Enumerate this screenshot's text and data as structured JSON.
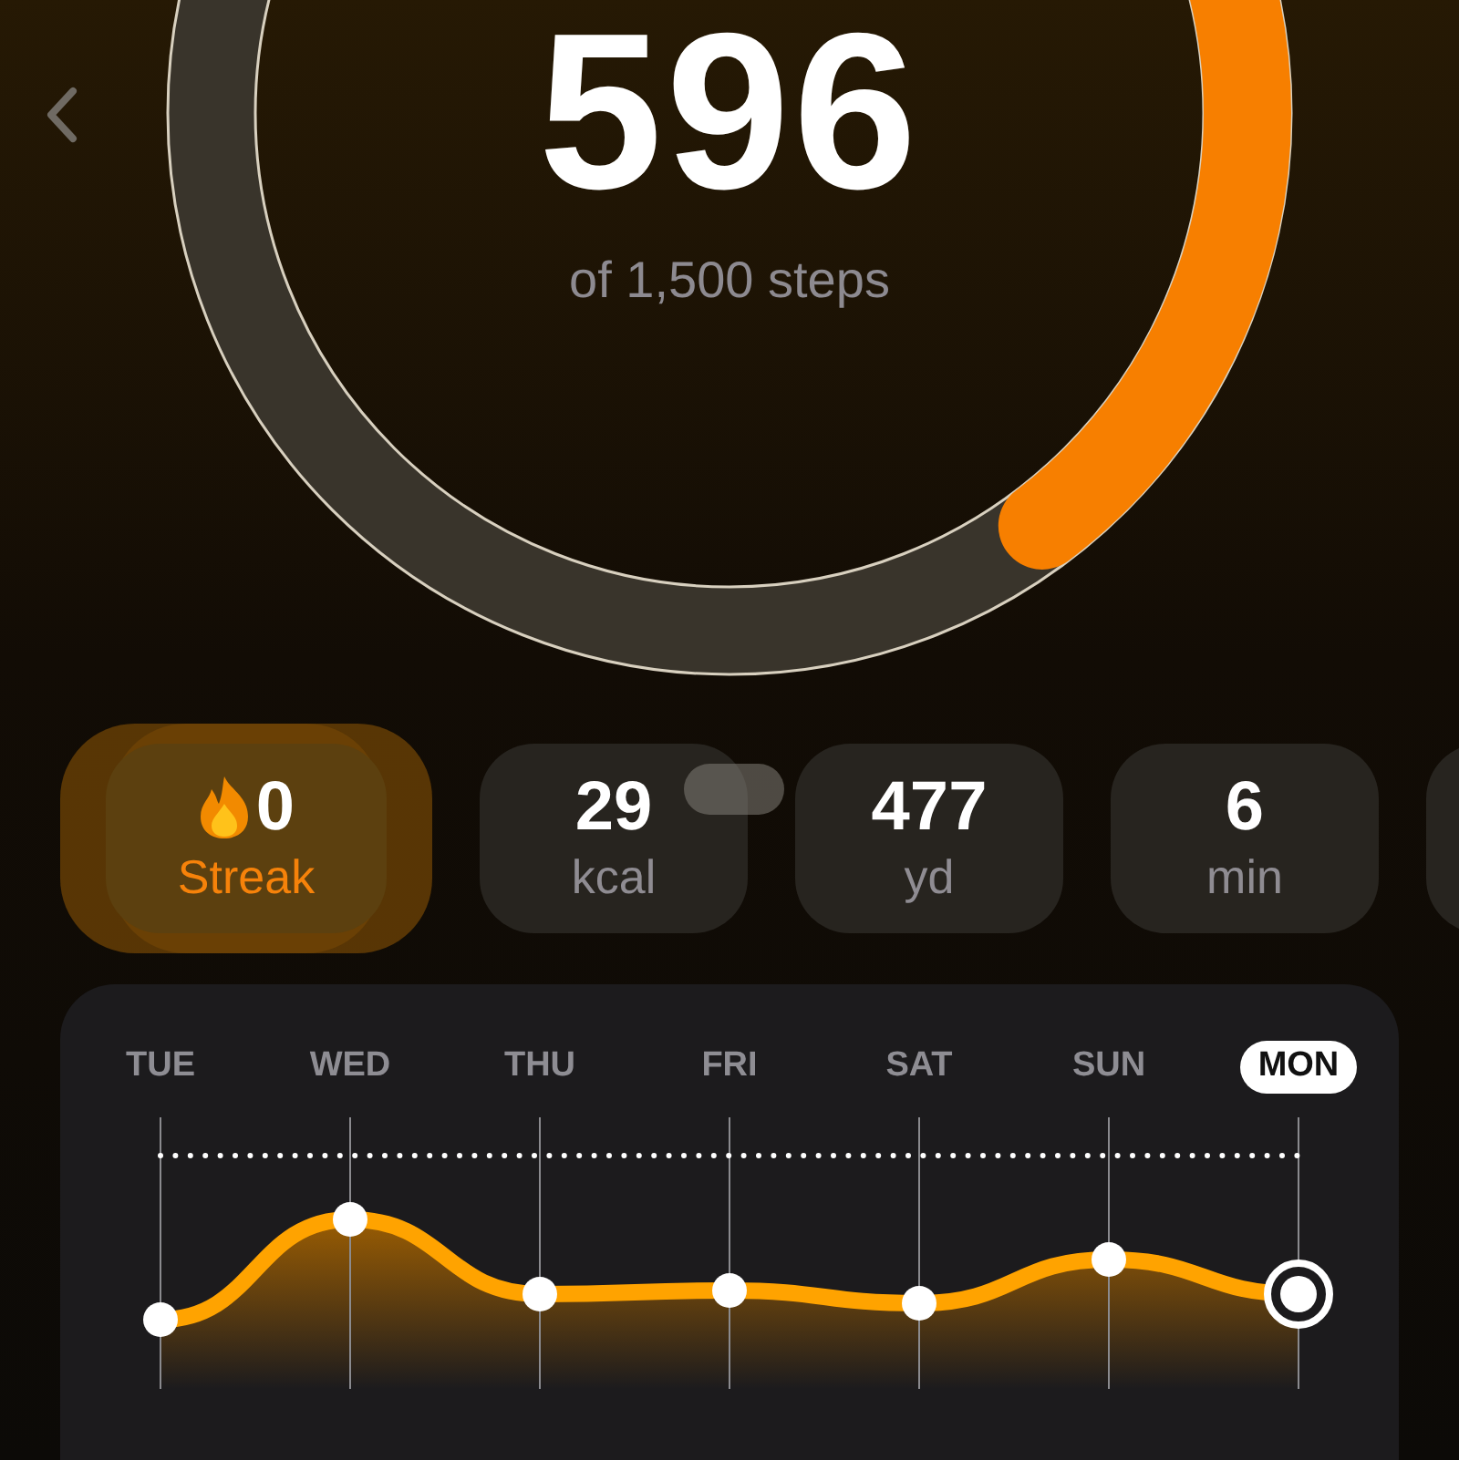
{
  "goal": {
    "steps": "596",
    "caption": "of 1,500 steps"
  },
  "stats": [
    {
      "kind": "streak",
      "value": "0",
      "label": "Streak",
      "selected": true
    },
    {
      "kind": "metric",
      "value": "29",
      "label": "kcal",
      "selected": false
    },
    {
      "kind": "metric",
      "value": "477",
      "label": "yd",
      "selected": false
    },
    {
      "kind": "metric",
      "value": "6",
      "label": "min",
      "selected": false
    }
  ],
  "days": [
    {
      "label": "TUE",
      "selected": false
    },
    {
      "label": "WED",
      "selected": false
    },
    {
      "label": "THU",
      "selected": false
    },
    {
      "label": "FRI",
      "selected": false
    },
    {
      "label": "SAT",
      "selected": false
    },
    {
      "label": "SUN",
      "selected": false
    },
    {
      "label": "MON",
      "selected": true
    }
  ]
}
